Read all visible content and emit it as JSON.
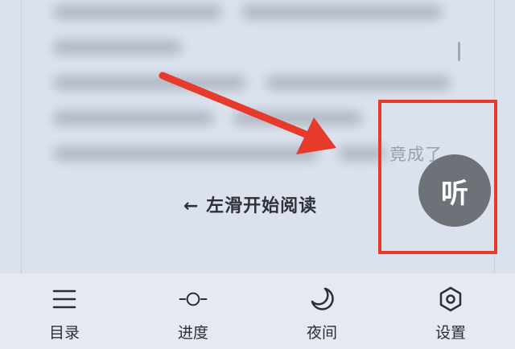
{
  "reader": {
    "partial_text": "竟成了",
    "swipe_hint": "← 左滑开始阅读",
    "listen_label": "听"
  },
  "bottom_nav": {
    "items": [
      {
        "label": "目录",
        "icon": "menu-list-icon"
      },
      {
        "label": "进度",
        "icon": "progress-slider-icon"
      },
      {
        "label": "夜间",
        "icon": "moon-icon"
      },
      {
        "label": "设置",
        "icon": "hexagon-settings-icon"
      }
    ]
  },
  "colors": {
    "highlight": "#e53a2c",
    "arrow": "#e53a2c",
    "listen_button": "#6d7178",
    "background": "#dbe2ee"
  }
}
